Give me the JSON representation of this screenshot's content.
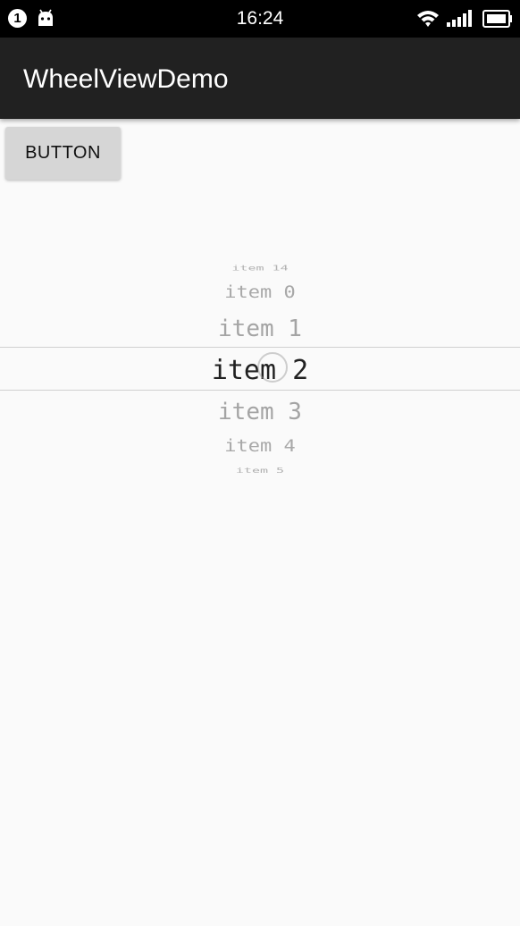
{
  "status_bar": {
    "notification_count": "1",
    "time": "16:24",
    "icons": [
      "android-notification-icon",
      "wifi-icon",
      "signal-icon",
      "battery-icon"
    ]
  },
  "app_bar": {
    "title": "WheelViewDemo",
    "background": "#212121"
  },
  "button": {
    "label": "BUTTON"
  },
  "wheel": {
    "items": [
      "item 14",
      "item 0",
      "item 1",
      "item 2",
      "item 3",
      "item 4",
      "item 5"
    ],
    "selected_item": "item 2",
    "selected_color": "#212121",
    "unselected_color": "#9e9e9e"
  }
}
